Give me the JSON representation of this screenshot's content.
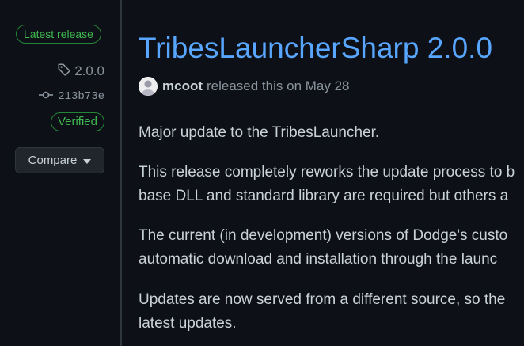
{
  "sidebar": {
    "latest_badge": "Latest release",
    "tag_label": "2.0.0",
    "commit_sha": "213b73e",
    "verified_badge": "Verified",
    "compare_label": "Compare"
  },
  "release": {
    "title": "TribesLauncherSharp 2.0.0",
    "author": "mcoot",
    "released_text": "released this on May 28",
    "paragraphs": [
      [
        "Major update to the TribesLauncher."
      ],
      [
        "This release completely reworks the update process to b",
        "base DLL and standard library are required but others a"
      ],
      [
        "The current (in development) versions of Dodge's custo",
        "automatic download and installation through the launc"
      ],
      [
        "Updates are now served from a different source, so the",
        "latest updates."
      ]
    ]
  },
  "colors": {
    "background": "#0d1117",
    "link": "#58a6ff",
    "success": "#3fb950",
    "text": "#c9d1d9",
    "muted": "#8b949e"
  },
  "icons": {
    "tag": "tag-icon",
    "commit": "git-commit-icon",
    "caret": "triangle-down-icon"
  }
}
